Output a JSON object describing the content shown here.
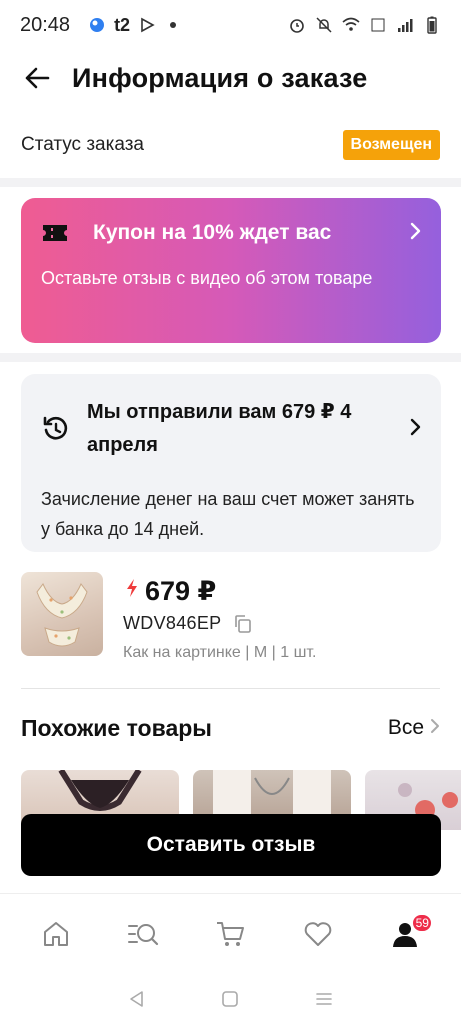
{
  "status_bar": {
    "time": "20:48",
    "carrier": "t2",
    "icons": [
      "dot-app-icon",
      "carrier-icon",
      "play-icon",
      "notification-dot-icon",
      "alarm-icon",
      "mute-icon",
      "wifi-icon",
      "volte-icon",
      "signal-icon",
      "battery-icon"
    ]
  },
  "header": {
    "title": "Информация о заказе"
  },
  "order_status": {
    "label": "Статус заказа",
    "badge": "Возмещен",
    "badge_color": "#f5a20a"
  },
  "coupon": {
    "title": "Купон на 10% ждет вас",
    "subtitle": "Оставьте отзыв с видео об этом товаре",
    "gradient_start": "#ef5c92",
    "gradient_end": "#9560dd"
  },
  "refund": {
    "title": "Мы отправили вам 679 ₽ 4 апреля",
    "text": "Зачисление денег на ваш счет может занять у банка до 14 дней."
  },
  "product": {
    "price": "679 ₽",
    "sku": "WDV846EP",
    "variant": "Как на картинке | M | 1 шт."
  },
  "similar": {
    "title": "Похожие товары",
    "all_label": "Все"
  },
  "cta": {
    "label": "Оставить отзыв"
  },
  "tabbar": {
    "items": [
      "home-icon",
      "catalog-search-icon",
      "cart-icon",
      "favorites-icon",
      "profile-icon"
    ],
    "profile_badge": "59",
    "badge_color": "#ee2d4a"
  },
  "system_nav": [
    "back-icon",
    "home-square-icon",
    "recents-icon"
  ]
}
